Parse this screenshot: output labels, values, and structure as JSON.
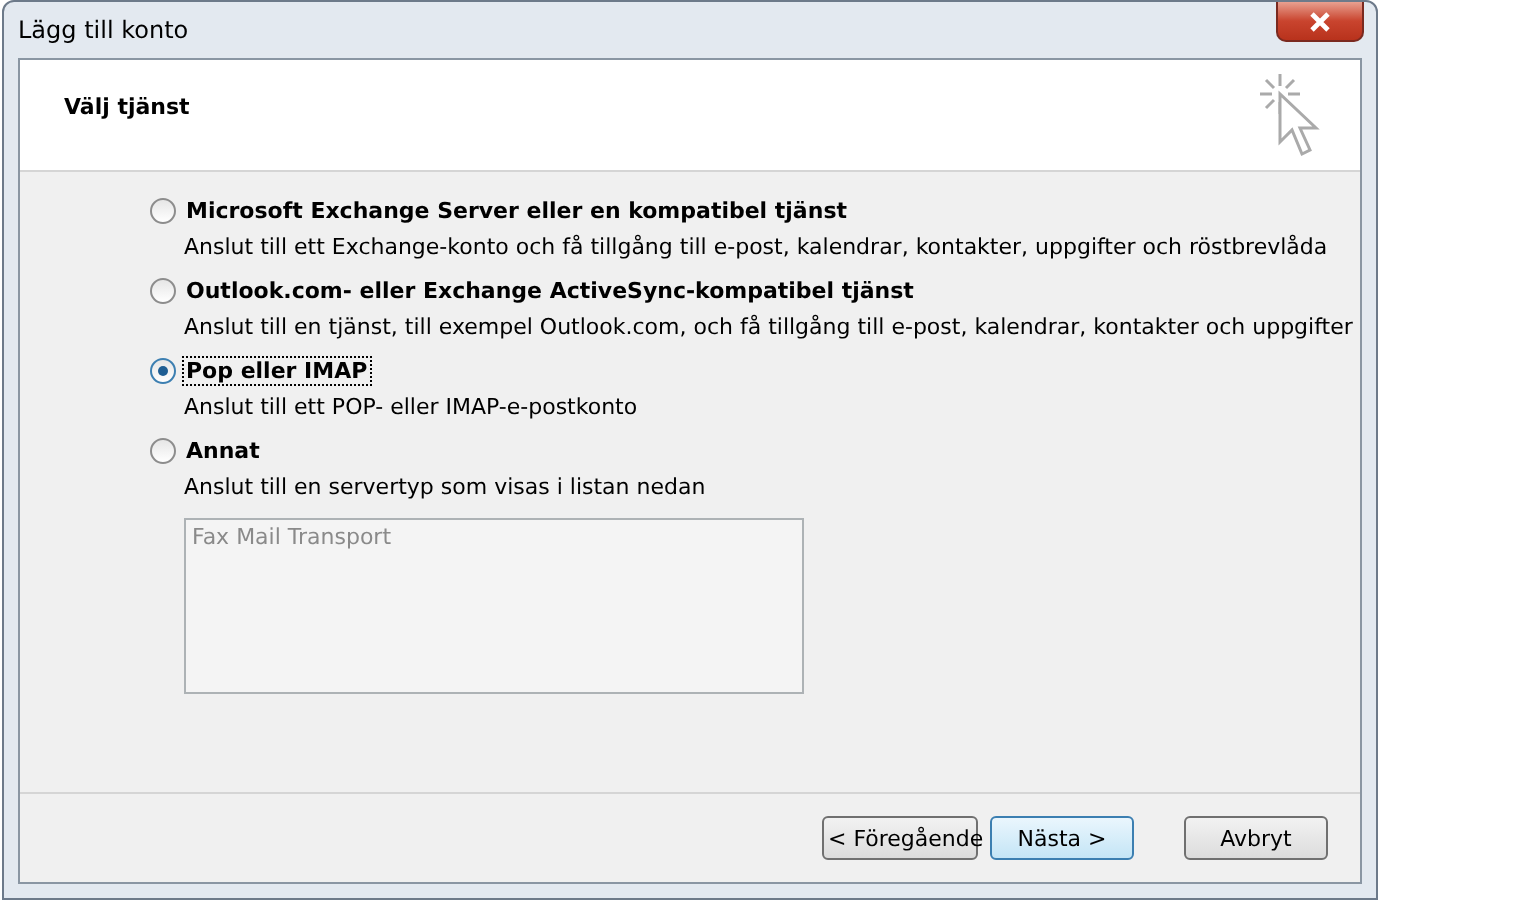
{
  "window": {
    "title": "Lägg till konto"
  },
  "header": {
    "title": "Välj tjänst"
  },
  "options": [
    {
      "label": "Microsoft Exchange Server eller en kompatibel tjänst",
      "description": "Anslut till ett Exchange-konto och få tillgång till e-post, kalendrar, kontakter, uppgifter och röstbrevlåda",
      "selected": false
    },
    {
      "label": "Outlook.com- eller Exchange ActiveSync-kompatibel tjänst",
      "description": "Anslut till en tjänst, till exempel Outlook.com, och få tillgång till e-post, kalendrar, kontakter och uppgifter",
      "selected": false
    },
    {
      "label": "Pop eller IMAP",
      "description": "Anslut till ett POP- eller IMAP-e-postkonto",
      "selected": true
    },
    {
      "label": "Annat",
      "description": "Anslut till en servertyp som visas i listan nedan",
      "selected": false
    }
  ],
  "server_list": {
    "items": [
      "Fax Mail Transport"
    ],
    "disabled": true
  },
  "buttons": [
    {
      "label": "< Föregående",
      "default": false
    },
    {
      "label": "Nästa >",
      "default": true
    },
    {
      "label": "Avbryt",
      "default": false
    }
  ]
}
